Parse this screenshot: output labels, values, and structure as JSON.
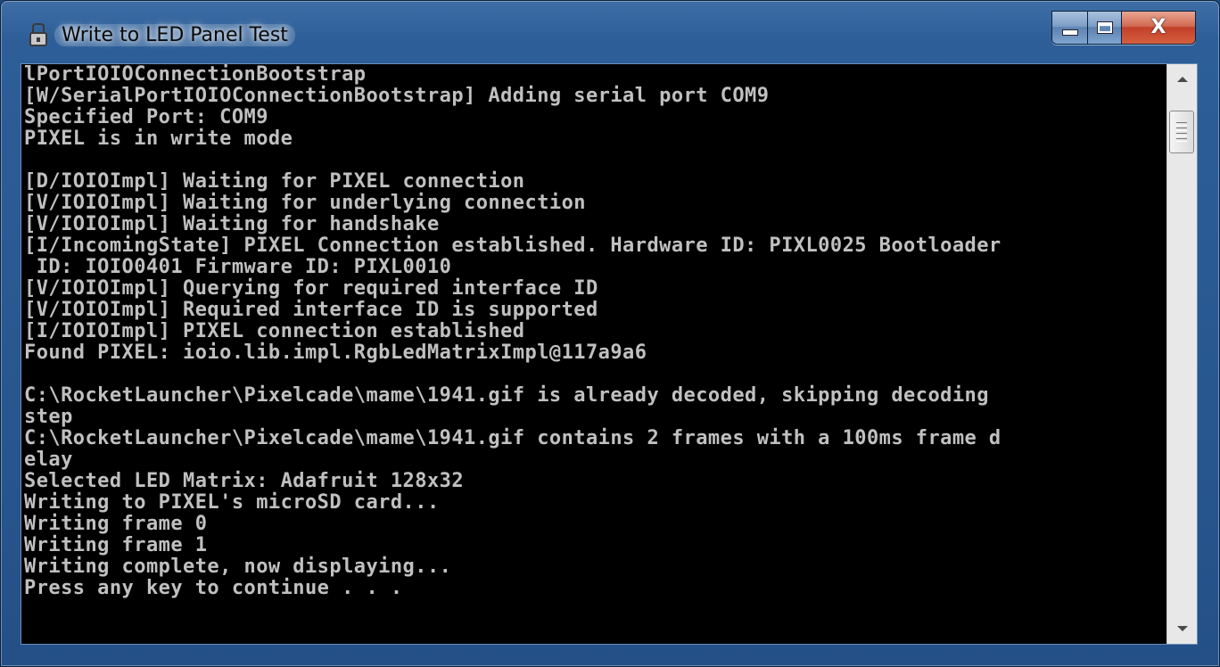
{
  "window": {
    "title": "Write to LED Panel Test",
    "icon": "console-app-icon",
    "buttons": {
      "minimize_icon": "minimize-icon",
      "maximize_icon": "maximize-icon",
      "close_label": "X"
    }
  },
  "console": {
    "background": "#000000",
    "foreground": "#c0c0c0",
    "lines": [
      "lPortIOIOConnectionBootstrap",
      "[W/SerialPortIOIOConnectionBootstrap] Adding serial port COM9",
      "Specified Port: COM9",
      "PIXEL is in write mode",
      "",
      "[D/IOIOImpl] Waiting for PIXEL connection",
      "[V/IOIOImpl] Waiting for underlying connection",
      "[V/IOIOImpl] Waiting for handshake",
      "[I/IncomingState] PIXEL Connection established. Hardware ID: PIXL0025 Bootloader",
      " ID: IOIO0401 Firmware ID: PIXL0010",
      "[V/IOIOImpl] Querying for required interface ID",
      "[V/IOIOImpl] Required interface ID is supported",
      "[I/IOIOImpl] PIXEL connection established",
      "Found PIXEL: ioio.lib.impl.RgbLedMatrixImpl@117a9a6",
      "",
      "C:\\RocketLauncher\\Pixelcade\\mame\\1941.gif is already decoded, skipping decoding",
      "step",
      "C:\\RocketLauncher\\Pixelcade\\mame\\1941.gif contains 2 frames with a 100ms frame d",
      "elay",
      "Selected LED Matrix: Adafruit 128x32",
      "Writing to PIXEL's microSD card...",
      "Writing frame 0",
      "Writing frame 1",
      "Writing complete, now displaying...",
      "Press any key to continue . . ."
    ]
  },
  "scrollbar": {
    "up_icon": "scroll-up-arrow-icon",
    "down_icon": "scroll-down-arrow-icon",
    "thumb_position_fraction": 0.0
  }
}
